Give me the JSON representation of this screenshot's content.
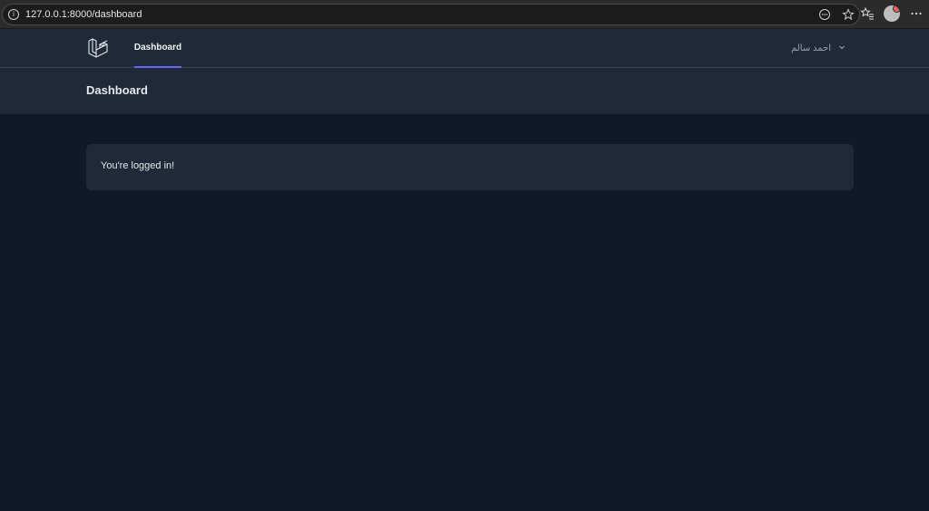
{
  "browser": {
    "url": "127.0.0.1:8000/dashboard",
    "icons": [
      "info-icon",
      "reader-mode-icon",
      "favorite-icon",
      "favorites-icon",
      "profile-avatar",
      "more-icon"
    ]
  },
  "nav": {
    "link_dashboard": "Dashboard",
    "user_name": "احمد سالم"
  },
  "header": {
    "title": "Dashboard"
  },
  "content": {
    "message": "You're logged in!"
  },
  "colors": {
    "page_bg": "#111827",
    "panel_bg": "#1f2937",
    "accent": "#6366f1",
    "browser_bg": "#2b2b2b"
  }
}
